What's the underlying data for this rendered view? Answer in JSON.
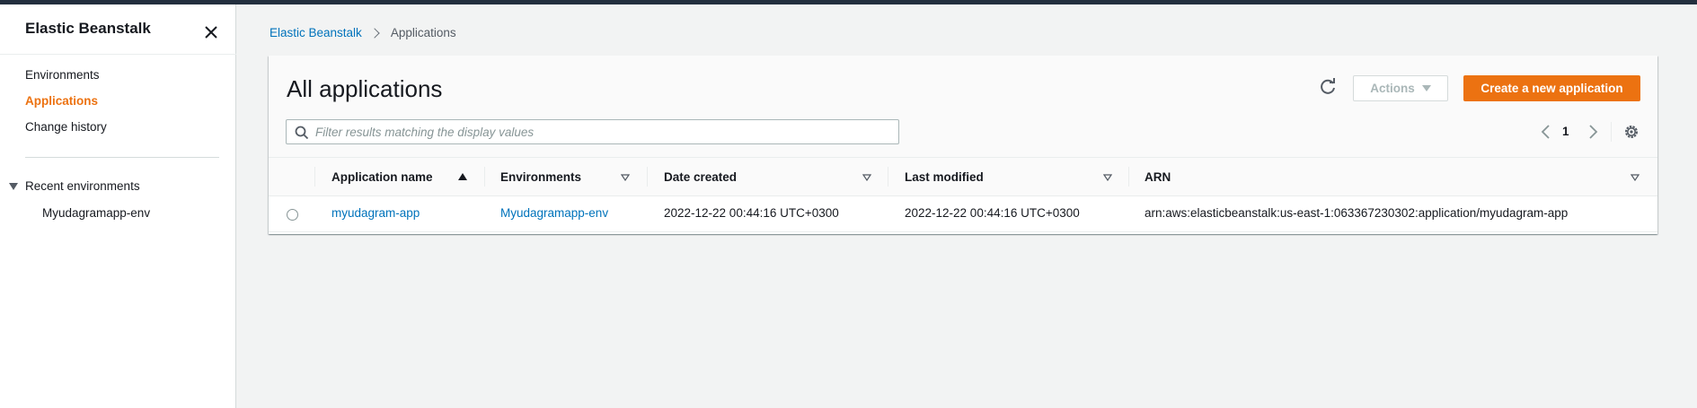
{
  "sidebar": {
    "title": "Elastic Beanstalk",
    "nav": [
      {
        "label": "Environments",
        "active": false
      },
      {
        "label": "Applications",
        "active": true
      },
      {
        "label": "Change history",
        "active": false
      }
    ],
    "recent_label": "Recent environments",
    "recent_items": [
      "Myudagramapp-env"
    ]
  },
  "breadcrumb": {
    "root": "Elastic Beanstalk",
    "current": "Applications"
  },
  "panel": {
    "title": "All applications",
    "actions_label": "Actions",
    "create_label": "Create a new application",
    "search_placeholder": "Filter results matching the display values",
    "page_number": "1"
  },
  "table": {
    "columns": [
      "Application name",
      "Environments",
      "Date created",
      "Last modified",
      "ARN"
    ],
    "sorted_column": "Application name",
    "sort_direction": "ascending",
    "rows": [
      {
        "name": "myudagram-app",
        "environments": "Myudagramapp-env",
        "date_created": "2022-12-22 00:44:16 UTC+0300",
        "last_modified": "2022-12-22 00:44:16 UTC+0300",
        "arn": "arn:aws:elasticbeanstalk:us-east-1:063367230302:application/myudagram-app"
      }
    ]
  },
  "colors": {
    "accent": "#ec7211",
    "link": "#0073bb",
    "topbar": "#232f3e",
    "background": "#f2f3f3"
  },
  "icons": [
    "close-icon",
    "refresh-icon",
    "search-icon",
    "chevron-left-icon",
    "chevron-right-icon",
    "settings-gear-icon",
    "caret-down-icon"
  ]
}
